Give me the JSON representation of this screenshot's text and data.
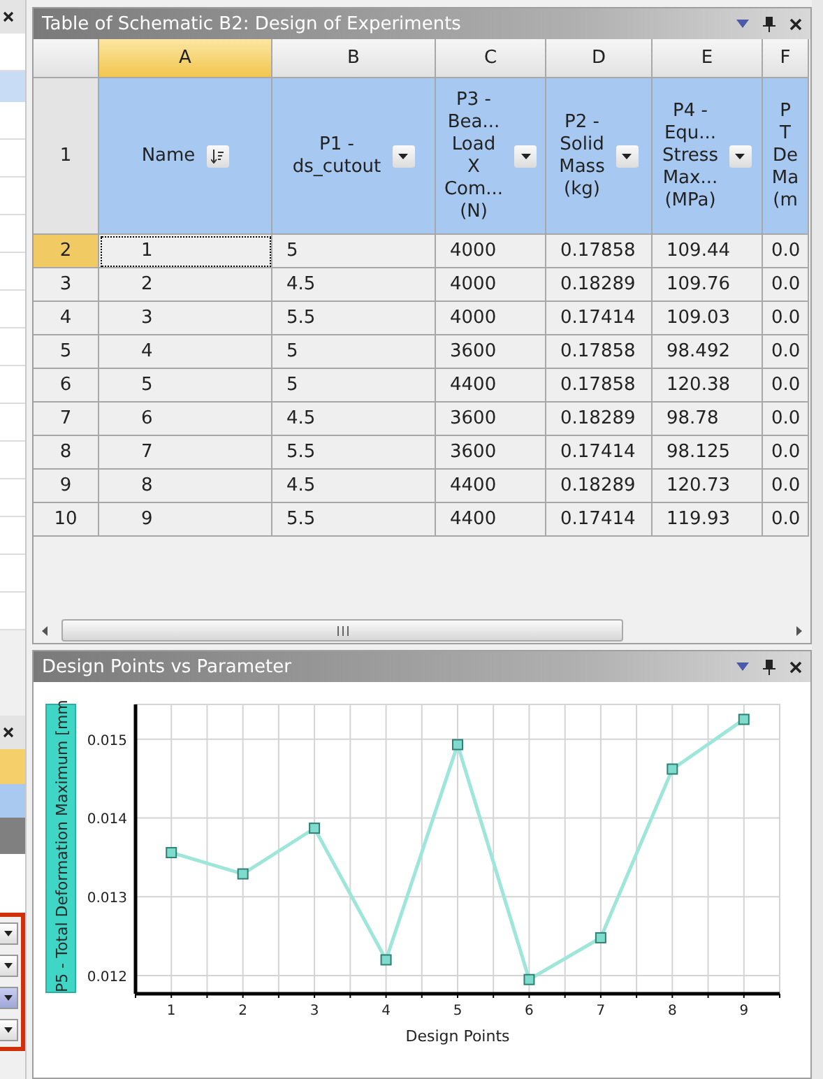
{
  "table_panel": {
    "title": "Table of Schematic B2: Design of Experiments",
    "header_row_number": "1",
    "columns": [
      {
        "letter": "A",
        "selected": true,
        "header": [
          "Name"
        ],
        "kind": "sort"
      },
      {
        "letter": "B",
        "selected": false,
        "header": [
          "P1 -",
          "ds_cutout"
        ],
        "kind": "filter"
      },
      {
        "letter": "C",
        "selected": false,
        "header": [
          "P3 -",
          "Bea...",
          "Load",
          "X",
          "Com...",
          "(N)"
        ],
        "kind": "filter"
      },
      {
        "letter": "D",
        "selected": false,
        "header": [
          "P2 -",
          "Solid",
          "Mass",
          "(kg)"
        ],
        "kind": "filter"
      },
      {
        "letter": "E",
        "selected": false,
        "header": [
          "P4 -",
          "Equ...",
          "Stress",
          "Max...",
          "(MPa)"
        ],
        "kind": "filter"
      },
      {
        "letter": "F",
        "selected": false,
        "header": [
          "P",
          "T",
          "De",
          "Ma",
          "(m"
        ],
        "kind": "plain"
      }
    ],
    "rows": [
      {
        "number": "2",
        "selected": true,
        "focused": true,
        "cells": [
          "1",
          "5",
          "4000",
          "0.17858",
          "109.44",
          "0.0"
        ]
      },
      {
        "number": "3",
        "selected": false,
        "focused": false,
        "cells": [
          "2",
          "4.5",
          "4000",
          "0.18289",
          "109.76",
          "0.0"
        ]
      },
      {
        "number": "4",
        "selected": false,
        "focused": false,
        "cells": [
          "3",
          "5.5",
          "4000",
          "0.17414",
          "109.03",
          "0.0"
        ]
      },
      {
        "number": "5",
        "selected": false,
        "focused": false,
        "cells": [
          "4",
          "5",
          "3600",
          "0.17858",
          "98.492",
          "0.0"
        ]
      },
      {
        "number": "6",
        "selected": false,
        "focused": false,
        "cells": [
          "5",
          "5",
          "4400",
          "0.17858",
          "120.38",
          "0.0"
        ]
      },
      {
        "number": "7",
        "selected": false,
        "focused": false,
        "cells": [
          "6",
          "4.5",
          "3600",
          "0.18289",
          "98.78",
          "0.0"
        ]
      },
      {
        "number": "8",
        "selected": false,
        "focused": false,
        "cells": [
          "7",
          "5.5",
          "3600",
          "0.17414",
          "98.125",
          "0.0"
        ]
      },
      {
        "number": "9",
        "selected": false,
        "focused": false,
        "cells": [
          "8",
          "4.5",
          "4400",
          "0.18289",
          "120.73",
          "0.0"
        ]
      },
      {
        "number": "10",
        "selected": false,
        "focused": false,
        "cells": [
          "9",
          "5.5",
          "4400",
          "0.17414",
          "119.93",
          "0.0"
        ]
      }
    ]
  },
  "chart_panel": {
    "title": "Design Points vs Parameter",
    "chart_data": {
      "type": "line",
      "xlabel": "Design Points",
      "ylabel": "P5 - Total Deformation Maximum  [mm",
      "x": [
        1,
        2,
        3,
        4,
        5,
        6,
        7,
        8,
        9
      ],
      "grid": true,
      "series": [
        {
          "color": "#9fe6da",
          "marker": "square",
          "values": [
            0.01356,
            0.01329,
            0.01387,
            0.0122,
            0.01493,
            0.01195,
            0.01248,
            0.01462,
            0.01525
          ]
        }
      ],
      "xlim": [
        0.5,
        9.5
      ],
      "ylim": [
        0.01177,
        0.01544
      ],
      "xticks": [
        1,
        2,
        3,
        4,
        5,
        6,
        7,
        8,
        9
      ],
      "yticks": [
        {
          "value": 0.012,
          "label": "0.012"
        },
        {
          "value": 0.013,
          "label": "0.013"
        },
        {
          "value": 0.014,
          "label": "0.014"
        },
        {
          "value": 0.015,
          "label": "0.015"
        }
      ]
    }
  }
}
